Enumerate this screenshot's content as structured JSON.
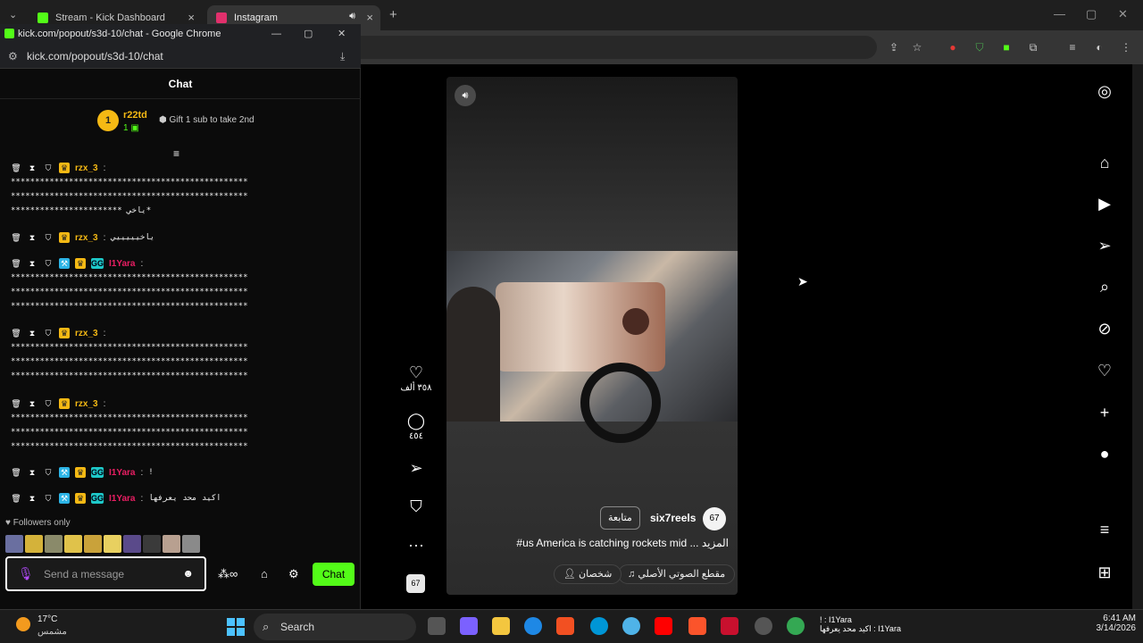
{
  "browser": {
    "tabs": [
      {
        "title": "Stream - Kick Dashboard",
        "color": "#53fc18"
      },
      {
        "title": "Instagram",
        "color": "#e1306c"
      }
    ]
  },
  "popout": {
    "title": "kick.com/popout/s3d-10/chat - Google Chrome",
    "url": "kick.com/popout/s3d-10/chat",
    "chat_header": "Chat",
    "gifter": {
      "rank": "1",
      "name": "r22td",
      "subs": "1",
      "gift_text": "Gift 1 sub to take 2nd"
    },
    "messages": [
      {
        "user": "rzx_3",
        "color": "#f5b914",
        "badges": [
          "crown"
        ],
        "text": "*************************************************\n*************************************************\n*********************** ياخي*"
      },
      {
        "user": "rzx_3",
        "color": "#f5b914",
        "badges": [
          "crown"
        ],
        "text": "ياخيييييي"
      },
      {
        "user": "I1Yara",
        "color": "#e91e63",
        "badges": [
          "hammer",
          "crown",
          "gg"
        ],
        "text": "*************************************************\n*************************************************\n*************************************************"
      },
      {
        "user": "rzx_3",
        "color": "#f5b914",
        "badges": [
          "crown"
        ],
        "text": "*************************************************\n*************************************************\n*************************************************"
      },
      {
        "user": "rzx_3",
        "color": "#f5b914",
        "badges": [
          "crown"
        ],
        "text": "*************************************************\n*************************************************\n*************************************************"
      },
      {
        "user": "I1Yara",
        "color": "#e91e63",
        "badges": [
          "hammer",
          "crown",
          "gg"
        ],
        "text": "!"
      },
      {
        "user": "I1Yara",
        "color": "#e91e63",
        "badges": [
          "hammer",
          "crown",
          "gg"
        ],
        "text": "اكيد محد يعرفها"
      }
    ],
    "followers_only": "Followers only",
    "input_placeholder": "Send a message",
    "send_label": "Chat"
  },
  "instagram": {
    "likes": "٣٥٨ ألف",
    "comments": "٤٥٤",
    "author": "six7reels",
    "follow_label": "متابعة",
    "caption": "#us America is catching rockets mid ... المزيد",
    "audio": "مقطع الصوتي الأصلي",
    "people": "شخصان"
  },
  "taskbar": {
    "temperature": "17°C",
    "condition": "مشمس",
    "search": "Search",
    "time": "6:41 AM",
    "date": "3/14/2026",
    "note_line1": "! : I1Yara",
    "note_line2": "اكيد محد يعرفها : I1Yara"
  }
}
